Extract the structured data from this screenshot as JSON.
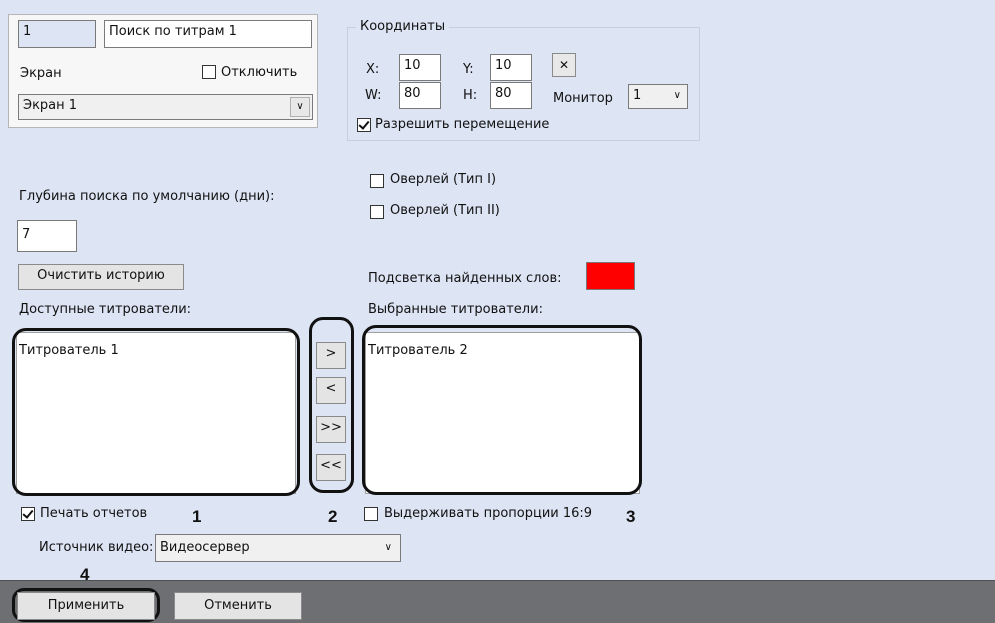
{
  "card": {
    "id": "1",
    "name": "Поиск по титрам 1",
    "screen_label": "Экран",
    "disable_label": "Отключить",
    "screen_value": "Экран 1"
  },
  "coordinates": {
    "title": "Координаты",
    "x_label": "X:",
    "x_value": "10",
    "y_label": "Y:",
    "y_value": "10",
    "w_label": "W:",
    "w_value": "80",
    "h_label": "H:",
    "h_value": "80",
    "reset_symbol": "✕",
    "monitor_label": "Монитор",
    "monitor_value": "1",
    "allow_move_label": "Разрешить перемещение"
  },
  "overlay": {
    "type1_label": "Оверлей (Тип I)",
    "type2_label": "Оверлей (Тип II)"
  },
  "search_depth": {
    "label": "Глубина поиска по умолчанию (дни):",
    "value": "7"
  },
  "clear_history_label": "Очистить историю",
  "highlight": {
    "label": "Подсветка найденных слов:",
    "color": "#ff0000"
  },
  "available": {
    "label": "Доступные титрователи:",
    "items": [
      "Титрователь 1"
    ]
  },
  "selected": {
    "label": "Выбранные титрователи:",
    "items": [
      "Титрователь 2"
    ]
  },
  "transfer": {
    "add": ">",
    "remove": "<",
    "add_all": ">>",
    "remove_all": "<<"
  },
  "print_reports_label": "Печать отчетов",
  "keep_ratio_label": "Выдерживать пропорции 16:9",
  "video_source": {
    "label": "Источник видео:",
    "value": "Видеосервер"
  },
  "footer": {
    "apply_label": "Применить",
    "cancel_label": "Отменить"
  },
  "callouts": [
    "1",
    "2",
    "3",
    "4"
  ],
  "colors": {
    "panel_bg": "#dde4f4",
    "footer_bg": "#6d6f72",
    "button_bg": "#e4e4e4"
  }
}
